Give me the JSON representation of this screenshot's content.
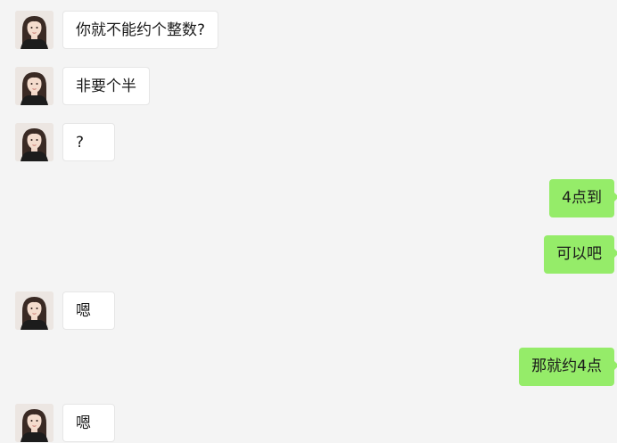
{
  "messages": [
    {
      "side": "in",
      "text": "你就不能约个整数?"
    },
    {
      "side": "in",
      "text": "非要个半"
    },
    {
      "side": "in",
      "text": "?"
    },
    {
      "side": "out",
      "text": "4点到"
    },
    {
      "side": "out",
      "text": "可以吧"
    },
    {
      "side": "in",
      "text": "嗯"
    },
    {
      "side": "out",
      "text": "那就约4点"
    },
    {
      "side": "in",
      "text": "嗯"
    }
  ],
  "colors": {
    "background": "#f4f4f4",
    "incoming_bubble": "#ffffff",
    "outgoing_bubble": "#95ec69",
    "text": "#1a1a1a"
  },
  "icons": {
    "avatar": "contact-avatar-icon"
  }
}
